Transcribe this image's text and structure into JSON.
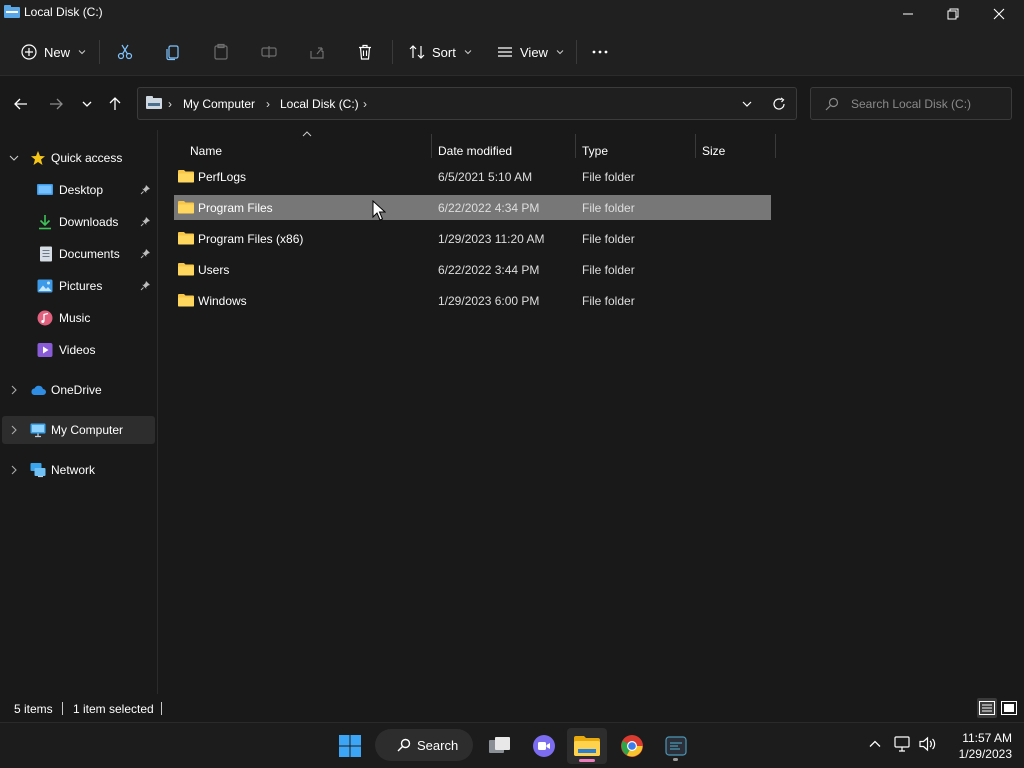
{
  "window": {
    "title": "Local Disk (C:)"
  },
  "toolbar": {
    "new_label": "New",
    "sort_label": "Sort",
    "view_label": "View"
  },
  "address": {
    "crumbs": [
      "My Computer",
      "Local Disk (C:)"
    ],
    "search_placeholder": "Search Local Disk (C:)"
  },
  "sidebar": {
    "quick_access": "Quick access",
    "items": [
      {
        "label": "Desktop",
        "icon": "desktop-icon",
        "pinned": true
      },
      {
        "label": "Downloads",
        "icon": "download-icon",
        "pinned": true
      },
      {
        "label": "Documents",
        "icon": "documents-icon",
        "pinned": true
      },
      {
        "label": "Pictures",
        "icon": "pictures-icon",
        "pinned": true
      },
      {
        "label": "Music",
        "icon": "music-icon",
        "pinned": false
      },
      {
        "label": "Videos",
        "icon": "videos-icon",
        "pinned": false
      }
    ],
    "onedrive": "OneDrive",
    "my_computer": "My Computer",
    "network": "Network"
  },
  "columns": {
    "name": "Name",
    "date": "Date modified",
    "type": "Type",
    "size": "Size"
  },
  "files": [
    {
      "name": "PerfLogs",
      "date": "6/5/2021 5:10 AM",
      "type": "File folder"
    },
    {
      "name": "Program Files",
      "date": "6/22/2022 4:34 PM",
      "type": "File folder",
      "selected": true
    },
    {
      "name": "Program Files (x86)",
      "date": "1/29/2023 11:20 AM",
      "type": "File folder"
    },
    {
      "name": "Users",
      "date": "6/22/2022 3:44 PM",
      "type": "File folder"
    },
    {
      "name": "Windows",
      "date": "1/29/2023 6:00 PM",
      "type": "File folder"
    }
  ],
  "status": {
    "count": "5 items",
    "selected": "1 item selected"
  },
  "taskbar": {
    "search_label": "Search",
    "time": "11:57 AM",
    "date": "1/29/2023"
  },
  "colors": {
    "folder": "#f8c748",
    "selected_row": "#777777",
    "accent": "#4cc2ff"
  }
}
